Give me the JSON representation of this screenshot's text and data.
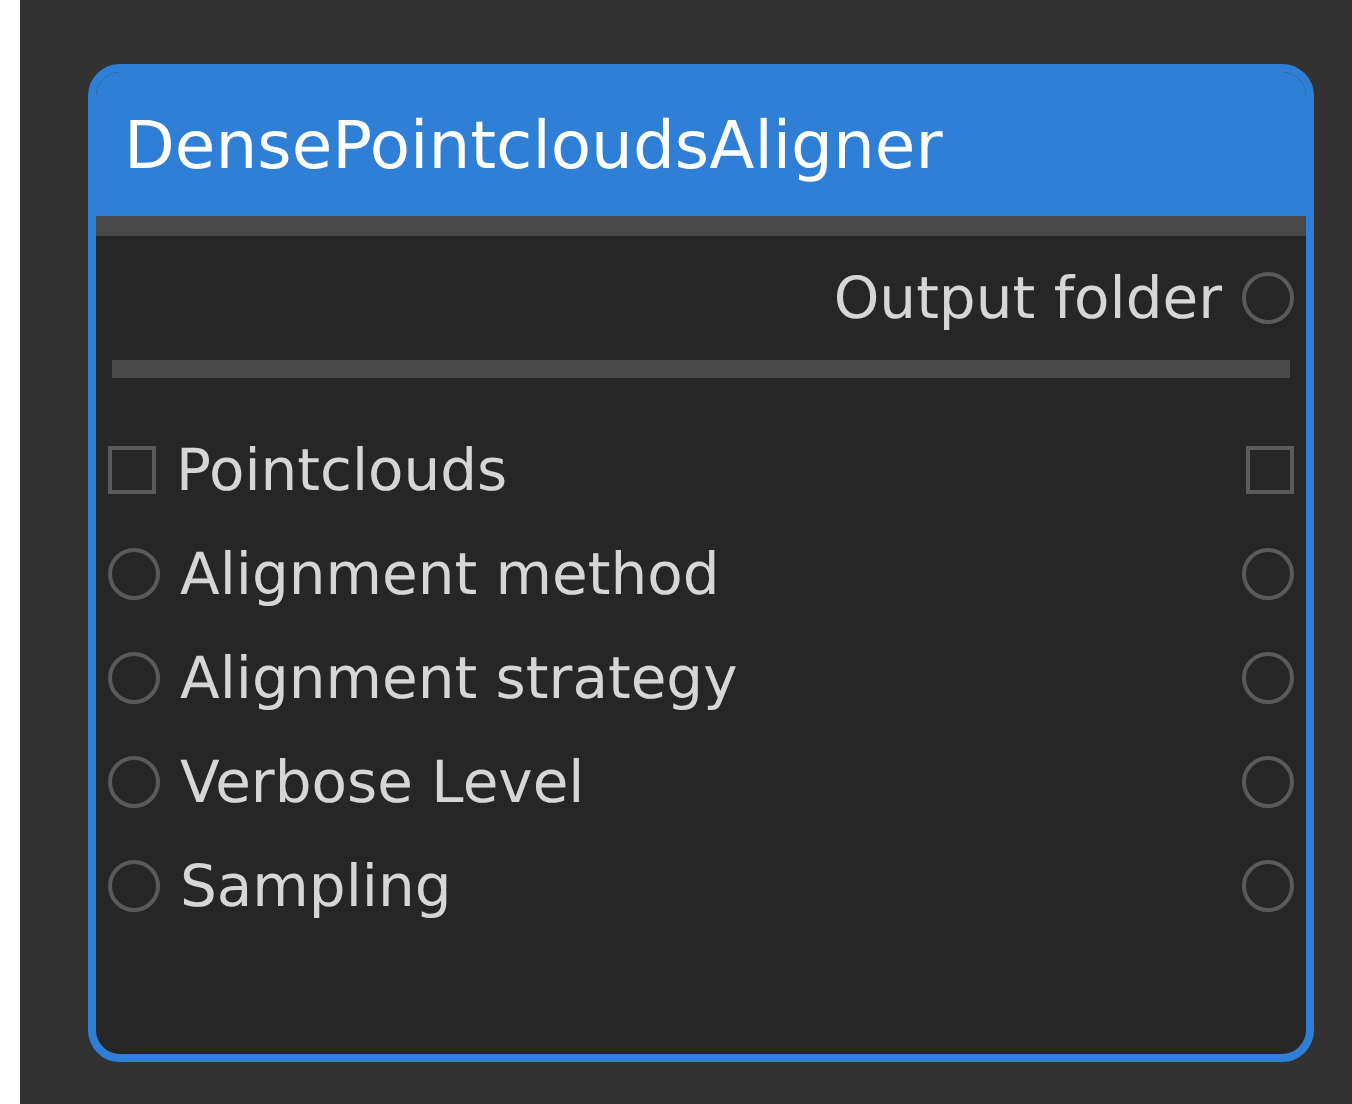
{
  "node": {
    "title": "DensePointcloudsAligner",
    "outputs": [
      {
        "label": "Output folder",
        "kind": "param"
      }
    ],
    "inputs": [
      {
        "label": "Pointclouds",
        "kind": "list"
      },
      {
        "label": "Alignment method",
        "kind": "param"
      },
      {
        "label": "Alignment strategy",
        "kind": "param"
      },
      {
        "label": "Verbose Level",
        "kind": "param"
      },
      {
        "label": "Sampling",
        "kind": "param"
      }
    ]
  }
}
